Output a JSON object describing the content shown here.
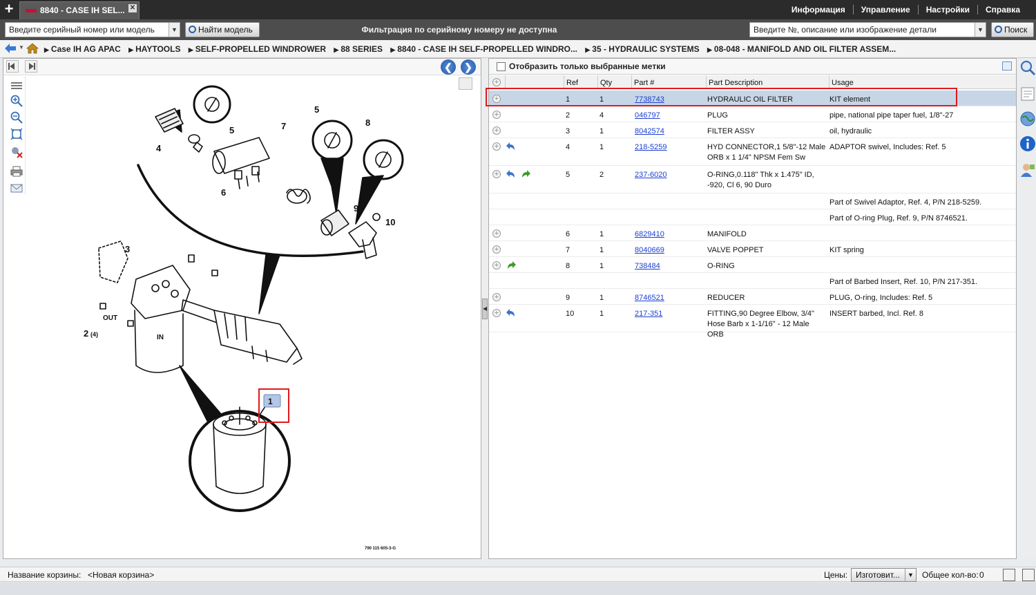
{
  "topbar": {
    "tab_title": "8840 - CASE IH SEL...",
    "menu": [
      "Информация",
      "Управление",
      "Настройки",
      "Справка"
    ]
  },
  "search": {
    "serial_placeholder": "Введите серийный номер или модель",
    "find_model_label": "Найти модель",
    "filter_message": "Фильтрация по серийному номеру не доступна",
    "part_placeholder": "Введите №, описание или изображение детали",
    "search_label": "Поиск"
  },
  "breadcrumb": [
    "Case IH AG APAC",
    "HAYTOOLS",
    "SELF-PROPELLED WINDROWER",
    "88 SERIES",
    "8840 - CASE IH SELF-PROPELLED WINDRO...",
    "35 - HYDRAULIC SYSTEMS",
    "08-048 - MANIFOLD AND OIL FILTER ASSEM..."
  ],
  "drawing": {
    "callouts": [
      "1",
      "2",
      "3",
      "4",
      "5",
      "5",
      "6",
      "7",
      "8",
      "9",
      "10"
    ],
    "qty_note": "(4)",
    "port_out": "OUT",
    "port_in": "IN",
    "figure_code": "790 115 605-3-G",
    "selected_callout": "1"
  },
  "parts_panel": {
    "filter_label": "Отобразить только выбранные метки",
    "columns": [
      "Ref",
      "Qty",
      "Part #",
      "Part Description",
      "Usage"
    ],
    "rows": [
      {
        "ref": "1",
        "qty": "1",
        "part": "7738743",
        "desc": "HYDRAULIC OIL FILTER",
        "usage": "KIT element",
        "selected": true
      },
      {
        "ref": "2",
        "qty": "4",
        "part": "046797",
        "desc": "PLUG",
        "usage": "pipe, national pipe taper fuel, 1/8\"-27"
      },
      {
        "ref": "3",
        "qty": "1",
        "part": "8042574",
        "desc": "FILTER ASSY",
        "usage": "oil, hydraulic"
      },
      {
        "ref": "4",
        "qty": "1",
        "part": "218-5259",
        "desc": "HYD CONNECTOR,1 5/8\"-12 Male ORB x 1 1/4\" NPSM Fem Sw",
        "usage": "ADAPTOR swivel, Includes: Ref. 5",
        "icons": [
          "back"
        ]
      },
      {
        "ref": "5",
        "qty": "2",
        "part": "237-6020",
        "desc": "O-RING,0.118\" Thk x 1.475\" ID, -920, Cl 6, 90 Duro",
        "usage": "",
        "icons": [
          "back",
          "forward"
        ]
      },
      {
        "ref": "",
        "qty": "",
        "part": "",
        "desc": "",
        "usage": "Part of Swivel Adaptor, Ref. 4, P/N 218-5259.",
        "note": true
      },
      {
        "ref": "",
        "qty": "",
        "part": "",
        "desc": "",
        "usage": "Part of O-ring Plug, Ref. 9, P/N 8746521.",
        "note": true
      },
      {
        "ref": "6",
        "qty": "1",
        "part": "6829410",
        "desc": "MANIFOLD",
        "usage": ""
      },
      {
        "ref": "7",
        "qty": "1",
        "part": "8040669",
        "desc": "VALVE POPPET",
        "usage": "KIT spring"
      },
      {
        "ref": "8",
        "qty": "1",
        "part": "738484",
        "desc": "O-RING",
        "usage": "",
        "icons": [
          "forward"
        ]
      },
      {
        "ref": "",
        "qty": "",
        "part": "",
        "desc": "",
        "usage": "Part of Barbed Insert, Ref. 10, P/N 217-351.",
        "note": true
      },
      {
        "ref": "9",
        "qty": "1",
        "part": "8746521",
        "desc": "REDUCER",
        "usage": "PLUG, O-ring, Includes: Ref. 5"
      },
      {
        "ref": "10",
        "qty": "1",
        "part": "217-351",
        "desc": "FITTING,90 Degree Elbow, 3/4\" Hose Barb x 1-1/16\" - 12 Male ORB",
        "usage": "INSERT barbed, Incl. Ref. 8",
        "icons": [
          "back"
        ]
      }
    ]
  },
  "footer": {
    "cart_label": "Название корзины:",
    "cart_name": "<Новая корзина>",
    "price_label": "Цены:",
    "price_value": "Изготовит...",
    "total_label": "Общее кол-во:",
    "total_value": "0"
  },
  "colors": {
    "highlight": "#e0191e",
    "selected_row": "#c7d6e7",
    "link": "#1a3fd1",
    "topbar": "#2b2b2b",
    "searchbar": "#4d4d4d"
  }
}
